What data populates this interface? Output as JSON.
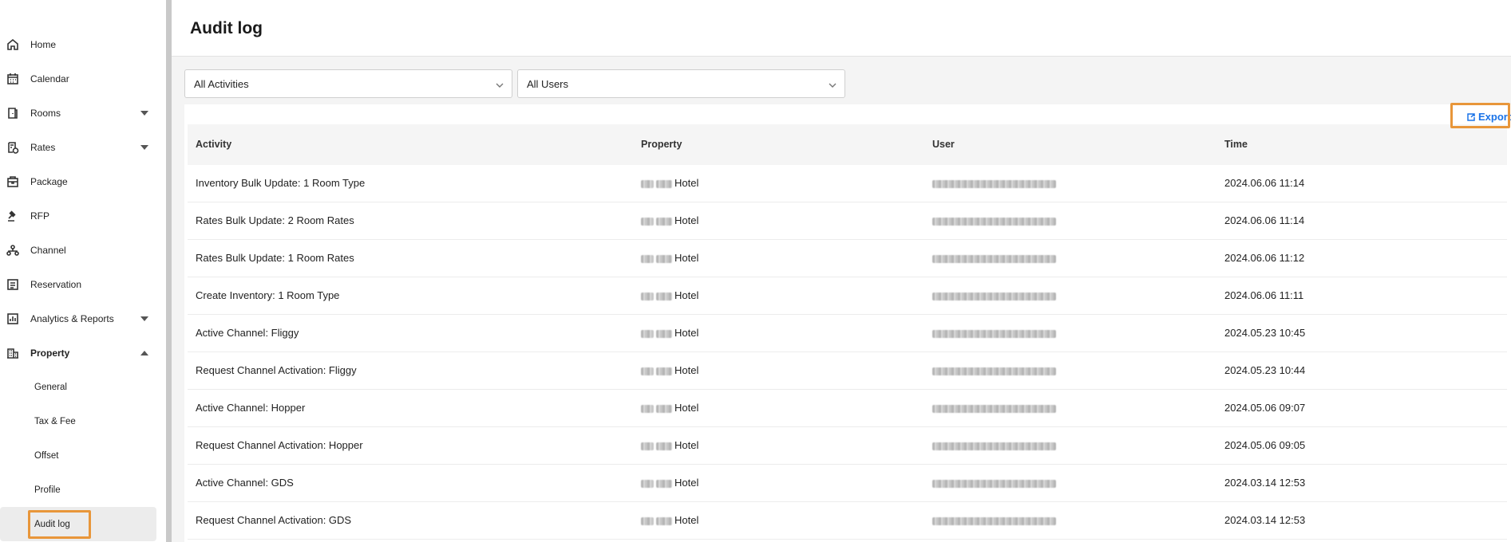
{
  "sidebar": {
    "items": [
      {
        "label": "Home",
        "icon": "home-icon",
        "caret": ""
      },
      {
        "label": "Calendar",
        "icon": "calendar-icon",
        "caret": ""
      },
      {
        "label": "Rooms",
        "icon": "door-icon",
        "caret": "down"
      },
      {
        "label": "Rates",
        "icon": "rates-icon",
        "caret": "down"
      },
      {
        "label": "Package",
        "icon": "package-icon",
        "caret": ""
      },
      {
        "label": "RFP",
        "icon": "gavel-icon",
        "caret": ""
      },
      {
        "label": "Channel",
        "icon": "network-icon",
        "caret": ""
      },
      {
        "label": "Reservation",
        "icon": "reservation-icon",
        "caret": ""
      },
      {
        "label": "Analytics & Reports",
        "icon": "chart-icon",
        "caret": "down"
      },
      {
        "label": "Property",
        "icon": "building-icon",
        "caret": "up"
      }
    ],
    "property_sub": [
      {
        "label": "General"
      },
      {
        "label": "Tax & Fee"
      },
      {
        "label": "Offset"
      },
      {
        "label": "Profile"
      },
      {
        "label": "Audit log",
        "active": true
      }
    ]
  },
  "header": {
    "title": "Audit log"
  },
  "filters": {
    "activity": "All Activities",
    "user": "All Users"
  },
  "toolbar": {
    "export_label": "Export"
  },
  "table": {
    "columns": [
      "Activity",
      "Property",
      "User",
      "Time"
    ],
    "property_suffix": "Hotel",
    "rows": [
      {
        "activity": "Inventory Bulk Update: 1 Room Type",
        "time": "2024.06.06 11:14"
      },
      {
        "activity": "Rates Bulk Update: 2 Room Rates",
        "time": "2024.06.06 11:14"
      },
      {
        "activity": "Rates Bulk Update: 1 Room Rates",
        "time": "2024.06.06 11:12"
      },
      {
        "activity": "Create Inventory: 1 Room Type",
        "time": "2024.06.06 11:11"
      },
      {
        "activity": "Active Channel: Fliggy",
        "time": "2024.05.23 10:45"
      },
      {
        "activity": "Request Channel Activation: Fliggy",
        "time": "2024.05.23 10:44"
      },
      {
        "activity": "Active Channel: Hopper",
        "time": "2024.05.06 09:07"
      },
      {
        "activity": "Request Channel Activation: Hopper",
        "time": "2024.05.06 09:05"
      },
      {
        "activity": "Active Channel: GDS",
        "time": "2024.03.14 12:53"
      },
      {
        "activity": "Request Channel Activation: GDS",
        "time": "2024.03.14 12:53"
      }
    ]
  },
  "colors": {
    "accent": "#1a73e8",
    "highlight": "#e8963a"
  }
}
